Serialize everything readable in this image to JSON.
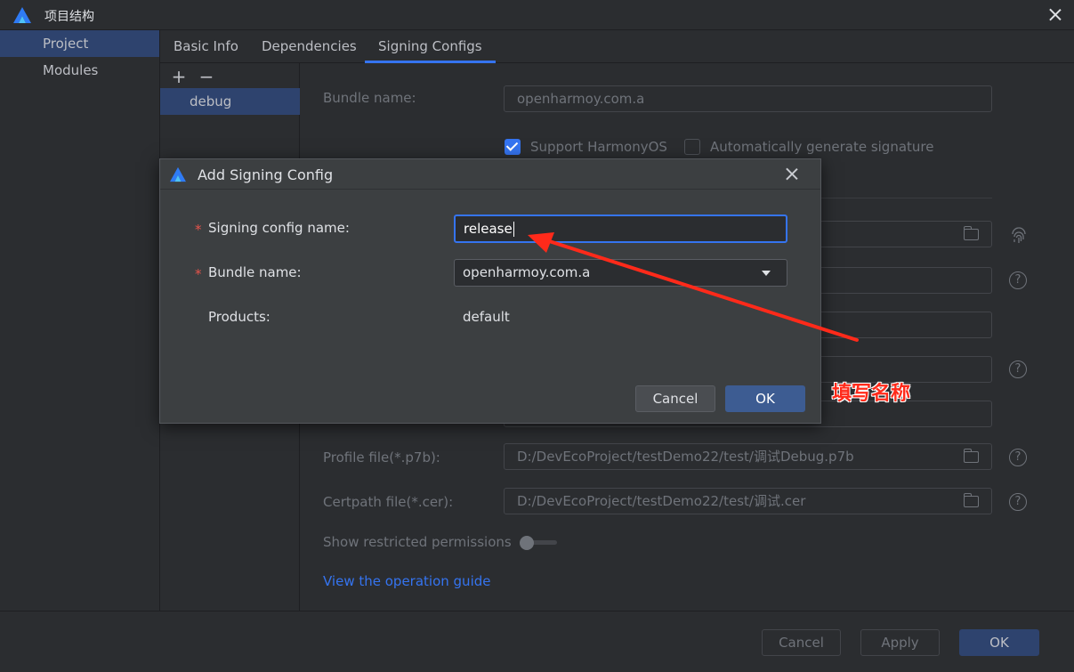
{
  "window": {
    "title": "项目结构"
  },
  "sidebar": {
    "items": [
      {
        "label": "Project",
        "active": true
      },
      {
        "label": "Modules",
        "active": false
      }
    ]
  },
  "tabs": [
    {
      "label": "Basic Info"
    },
    {
      "label": "Dependencies"
    },
    {
      "label": "Signing Configs",
      "active": true
    }
  ],
  "config_list": {
    "add_symbol": "+",
    "remove_symbol": "−",
    "items": [
      "debug"
    ]
  },
  "form": {
    "bundle_name_label": "Bundle name:",
    "bundle_name_value": "openharmoy.com.a",
    "support_harmonyos_label": "Support HarmonyOS",
    "support_harmonyos_checked": true,
    "auto_signature_label": "Automatically generate signature",
    "auto_signature_checked": false,
    "profile_label": "Profile file(*.p7b):",
    "profile_value": "D:/DevEcoProject/testDemo22/test/调试Debug.p7b",
    "certpath_label": "Certpath file(*.cer):",
    "certpath_value": "D:/DevEcoProject/testDemo22/test/调试.cer",
    "restricted_label": "Show restricted permissions",
    "restricted_on": false,
    "guide_link": "View the operation guide"
  },
  "footer": {
    "cancel_label": "Cancel",
    "apply_label": "Apply",
    "ok_label": "OK"
  },
  "dialog": {
    "title": "Add Signing Config",
    "required_mark": "*",
    "config_name_label": "Signing config name:",
    "config_name_value": "release",
    "bundle_label": "Bundle name:",
    "bundle_value": "openharmoy.com.a",
    "products_label": "Products:",
    "products_value": "default",
    "cancel_label": "Cancel",
    "ok_label": "OK"
  },
  "annotation": {
    "text": "填写名称",
    "color": "#ff2a1a"
  },
  "colors": {
    "accent": "#3574f0",
    "selection": "#2e436e",
    "background": "#2b2d30"
  }
}
